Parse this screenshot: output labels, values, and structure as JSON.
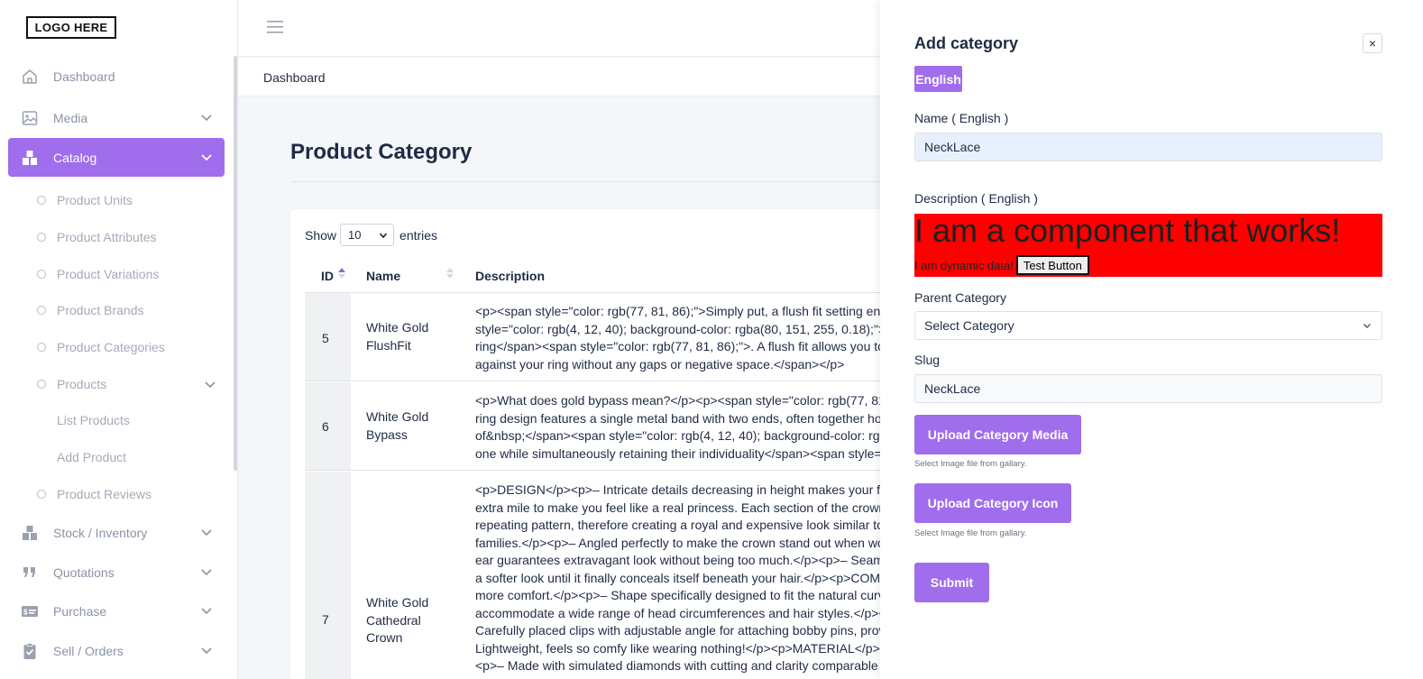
{
  "logo": {
    "text": "LOGO HERE"
  },
  "sidebar": {
    "items": [
      {
        "label": "Dashboard",
        "icon": "home-icon"
      },
      {
        "label": "Media",
        "icon": "image-icon"
      },
      {
        "label": "Catalog",
        "icon": "boxes-icon",
        "active": true
      },
      {
        "label": "Stock / Inventory",
        "icon": "boxes-icon"
      },
      {
        "label": "Quotations",
        "icon": "quote-icon"
      },
      {
        "label": "Purchase",
        "icon": "money-card-icon"
      },
      {
        "label": "Sell / Orders",
        "icon": "clipboard-check-icon"
      }
    ],
    "catalog_sub": [
      "Product Units",
      "Product Attributes",
      "Product Variations",
      "Product Brands",
      "Product Categories",
      "Products",
      "Product Reviews"
    ],
    "products_sub": [
      "List Products",
      "Add Product"
    ]
  },
  "breadcrumb": "Dashboard",
  "page": {
    "title": "Product Category"
  },
  "table": {
    "show_label": "Show",
    "entries_value": "10",
    "entries_label": "entries",
    "columns": [
      "ID",
      "Name",
      "Description"
    ],
    "rows": [
      {
        "id": "5",
        "name": "White Gold FlushFit",
        "description": "<p><span style=\"color: rgb(77, 81, 86);\">Simply put, a flush fit setting engagement\nstyle=\"color: rgb(4, 12, 40); background-color: rgba(80, 151, 255, 0.18);\">a wedding\nring</span><span style=\"color: rgb(77, 81, 86);\">. A flush fit allows you to have your\nagainst your ring without any gaps or negative space.</span></p>"
      },
      {
        "id": "6",
        "name": "White Gold Bypass",
        "description": "<p>What does gold bypass mean?</p><p><span style=\"color: rgb(77, 81, 86);\">\nring design features a single metal band with two ends, often together holding a\nof&nbsp;</span><span style=\"color: rgb(4, 12, 40); background-color: rgba(80, 151,\none while simultaneously retaining their individuality</span><span style=\"color:"
      },
      {
        "id": "7",
        "name": "White Gold Cathedral Crown",
        "description": "<p>DESIGN</p><p>– Intricate details decreasing in height makes your face look\nextra mile to make you feel like a real princess. Each section of the crown is made\nrepeating pattern, therefore creating a royal and expensive look similar to jewelry\nfamilies.</p><p>– Angled perfectly to make the crown stand out when worn.</p>\near guarantees extravagant look without being too much.</p><p>– Seamless design\na softer look until it finally conceals itself beneath your hair.</p><p>COMFORT</p>\nmore comfort.</p><p>– Shape specifically designed to fit the natural curvature\naccommodate a wide range of head circumferences and hair styles.</p><p>– D\nCarefully placed clips with adjustable angle for attaching bobby pins, providing\nLightweight, feels so comfy like wearing nothing!</p><p>MATERIAL</p><p>– I\n<p>– Made with simulated diamonds with cutting and clarity comparable to real"
      }
    ]
  },
  "drawer": {
    "title": "Add category",
    "close": "×",
    "lang_tab": "English",
    "name_label": "Name ( English )",
    "name_value": "NeckLace",
    "desc_label": "Description ( English )",
    "component_heading": "I am a component that works!",
    "component_text": "I am dynamic data!",
    "test_button": "Test Button",
    "parent_label": "Parent Category",
    "parent_value": "Select Category",
    "slug_label": "Slug",
    "slug_value": "NeckLace",
    "upload_media": "Upload Category Media",
    "upload_media_hint": "Select Image file from gallary.",
    "upload_icon": "Upload Category Icon",
    "upload_icon_hint": "Select Image file from gallary.",
    "submit": "Submit"
  },
  "colors": {
    "accent": "#a06ded",
    "component_bg": "#ff0000"
  }
}
